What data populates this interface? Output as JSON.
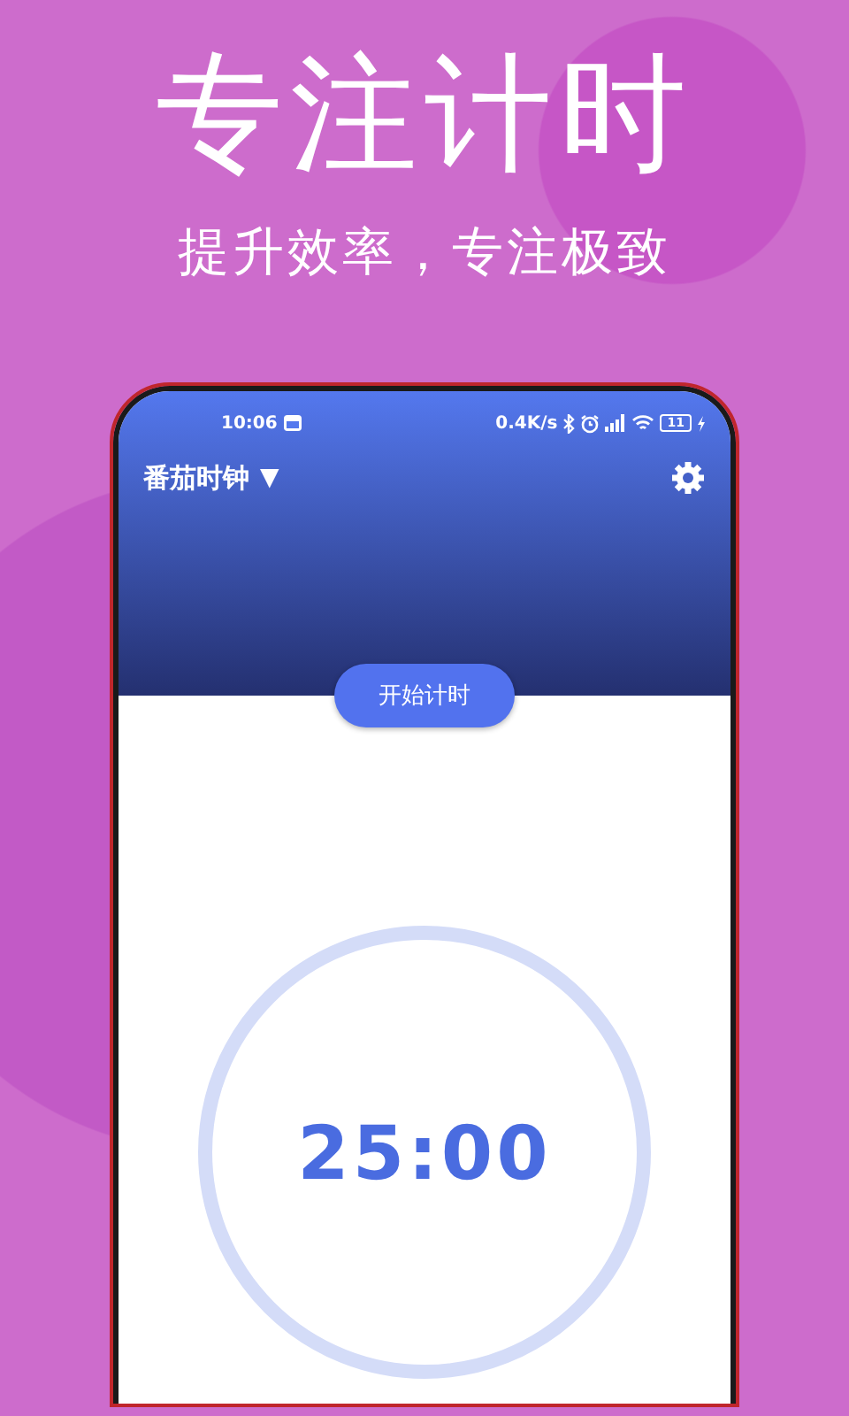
{
  "headline": "专注计时",
  "subtitle": "提升效率，专注极致",
  "phone": {
    "status_bar": {
      "time": "10:06",
      "network_speed": "0.4K/s",
      "battery": "11"
    },
    "app_bar": {
      "title": "番茄时钟",
      "dropdown": "▼"
    },
    "start_button": "开始计时",
    "timer": {
      "time": "25:00"
    }
  }
}
